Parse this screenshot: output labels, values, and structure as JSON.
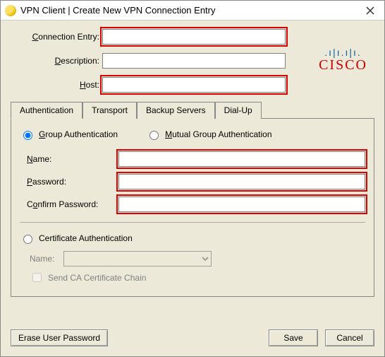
{
  "window": {
    "title": "VPN Client  |  Create New VPN Connection Entry"
  },
  "top_fields": {
    "connection_entry_label": "Connection Entry:",
    "connection_entry_value": "",
    "description_label": "Description:",
    "description_value": "",
    "host_label": "Host:",
    "host_value": ""
  },
  "logo": {
    "brand": "CISCO"
  },
  "tabs": [
    {
      "label": "Authentication",
      "active": true
    },
    {
      "label": "Transport",
      "active": false
    },
    {
      "label": "Backup Servers",
      "active": false
    },
    {
      "label": "Dial-Up",
      "active": false
    }
  ],
  "auth": {
    "group_auth_label": "Group Authentication",
    "mutual_group_auth_label": "Mutual Group Authentication",
    "selected_mode": "group",
    "name_label": "Name:",
    "name_value": "",
    "password_label": "Password:",
    "password_value": "",
    "confirm_password_label": "Confirm Password:",
    "confirm_password_value": "",
    "cert_auth_label": "Certificate Authentication",
    "cert_name_label": "Name:",
    "cert_name_value": "",
    "send_ca_chain_label": "Send CA Certificate Chain",
    "send_ca_chain_checked": false
  },
  "buttons": {
    "erase_user_password": "Erase User Password",
    "save": "Save",
    "cancel": "Cancel"
  }
}
